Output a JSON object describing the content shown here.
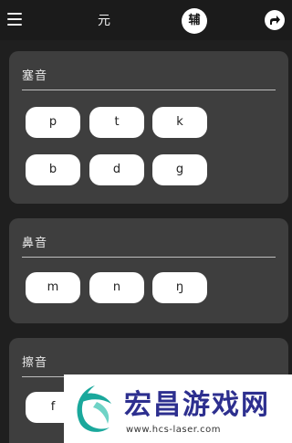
{
  "topbar": {
    "tabs": [
      {
        "label": "元"
      },
      {
        "label": "辅"
      }
    ]
  },
  "sections": [
    {
      "title": "塞音",
      "keys": [
        "p",
        "t",
        "k",
        "b",
        "d",
        "g"
      ]
    },
    {
      "title": "鼻音",
      "keys": [
        "m",
        "n",
        "ŋ"
      ]
    },
    {
      "title": "擦音",
      "keys": [
        "f"
      ]
    }
  ],
  "watermark": {
    "title": "宏昌游戏网",
    "url": "www.hcs-laser.com",
    "colors": {
      "title": "#2d2f8f",
      "logo": "#1aa89c"
    }
  }
}
